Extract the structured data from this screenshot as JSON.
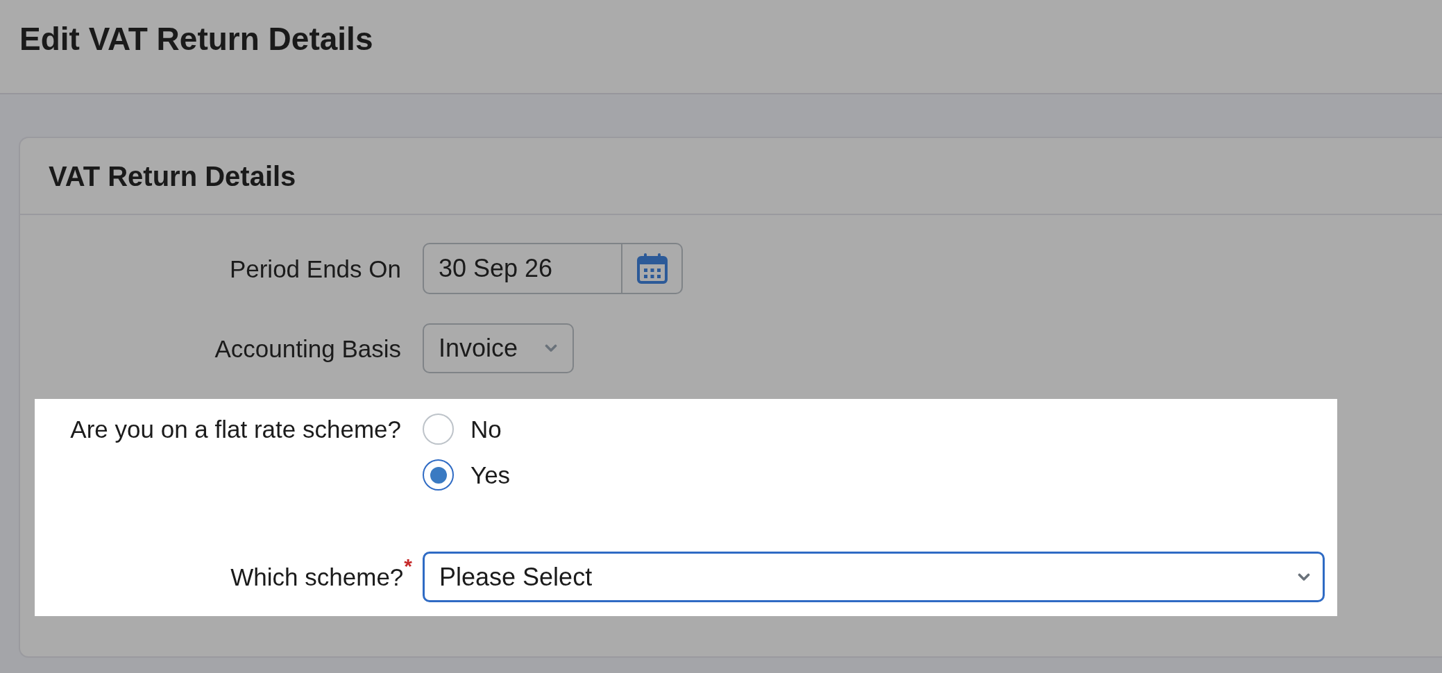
{
  "page": {
    "title": "Edit VAT Return Details"
  },
  "card": {
    "title": "VAT Return Details"
  },
  "sections": [
    {
      "highlighted": false,
      "fields": [
        {
          "kind": "date",
          "label": "Period Ends On",
          "value": "30 Sep 26"
        },
        {
          "kind": "select",
          "label": "Accounting Basis",
          "value": "Invoice",
          "focused": false
        }
      ]
    },
    {
      "highlighted": true,
      "fields": [
        {
          "kind": "radio",
          "label": "Are you on a flat rate scheme?",
          "options": [
            {
              "label": "No",
              "selected": false
            },
            {
              "label": "Yes",
              "selected": true
            }
          ]
        },
        {
          "kind": "select",
          "label": "Which scheme?",
          "required_mark": "*",
          "value": "Please Select",
          "focused": true
        }
      ]
    }
  ]
}
